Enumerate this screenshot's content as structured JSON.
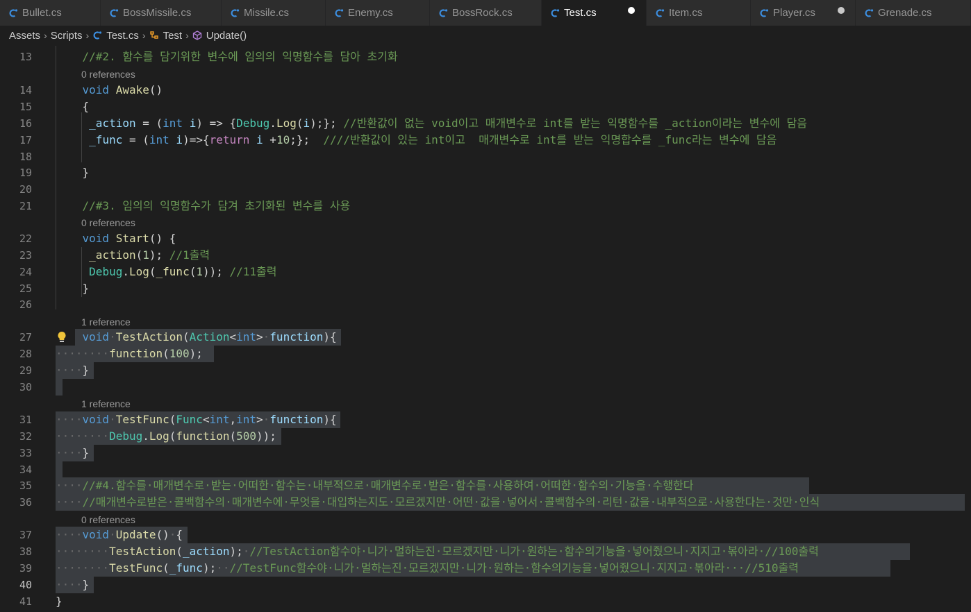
{
  "tabs": [
    {
      "label": "Bullet.cs",
      "active": false,
      "modified": false
    },
    {
      "label": "BossMissile.cs",
      "active": false,
      "modified": false
    },
    {
      "label": "Missile.cs",
      "active": false,
      "modified": false
    },
    {
      "label": "Enemy.cs",
      "active": false,
      "modified": false
    },
    {
      "label": "BossRock.cs",
      "active": false,
      "modified": false
    },
    {
      "label": "Test.cs",
      "active": true,
      "modified": true
    },
    {
      "label": "Item.cs",
      "active": false,
      "modified": false
    },
    {
      "label": "Player.cs",
      "active": false,
      "modified": true
    },
    {
      "label": "Grenade.cs",
      "active": false,
      "modified": false
    }
  ],
  "breadcrumb": {
    "assets": "Assets",
    "scripts": "Scripts",
    "file": "Test.cs",
    "class": "Test",
    "method": "Update()"
  },
  "code_lens": {
    "zero_refs": "0 references",
    "one_ref": "1 reference"
  },
  "line_numbers": [
    "13",
    "14",
    "15",
    "16",
    "17",
    "18",
    "19",
    "20",
    "21",
    "22",
    "23",
    "24",
    "25",
    "26",
    "27",
    "28",
    "29",
    "30",
    "31",
    "32",
    "33",
    "34",
    "35",
    "36",
    "37",
    "38",
    "39",
    "40",
    "41"
  ],
  "code": {
    "l13_comment": "//#2. 함수를 담기위한 변수에 임의의 익명함수를 담아 초기화",
    "l16_comment": "//반환값이 없는 void이고 매개변수로 int를 받는 익명함수를 _action이라는 변수에 담음",
    "l17_comment": "////반환값이 있는 int이고  매개변수로 int를 받는 익명합수를 _func라는 변수에 담음",
    "l21_comment": "//#3. 임의의 익명함수가 담겨 초기화된 변수를 사용",
    "l23_comment": "//1출력",
    "l24_comment": "//11출력",
    "l35_comment": "//#4.함수를·매개변수로·받는·어떠한·함수는·내부적으로·매개변수로·받은·함수를·사용하여·어떠한·함수의·기능을·수행한다",
    "l36_comment": "//매개변수로받은·콜백함수의·매개변수에·무엇을·대입하는지도·모르겠지만·어떤·값을·넣어서·콜백함수의·리턴·값을·내부적으로·사용한다는·것만·인식",
    "l38_comment": "//TestAction함수야·니가·멀하는진·모르겠지만·니가·원하는·함수의기능을·넣어줬으니·지지고·볶아라·//100출력",
    "l39_comment": "//TestFunc함수야·니가·멀하는진·모르겠지만·니가·원하는·함수의기능을·넣어줬으니·지지고·볶아라···//510출력"
  },
  "colors": {
    "editor_bg": "#1e1e1e",
    "tab_bg": "#2d2d2d",
    "selection": "#3a3d41",
    "keyword": "#569cd6",
    "type": "#4ec9b0",
    "function": "#dcdcaa",
    "variable": "#9cdcfe",
    "number": "#b5cea8",
    "comment": "#6a9955",
    "csharp_icon": "#3c8ee0"
  },
  "icons": {
    "tab_file": "csharp-file-icon",
    "class": "class-icon",
    "method": "method-cube-icon",
    "lightbulb": "lightbulb-icon"
  }
}
